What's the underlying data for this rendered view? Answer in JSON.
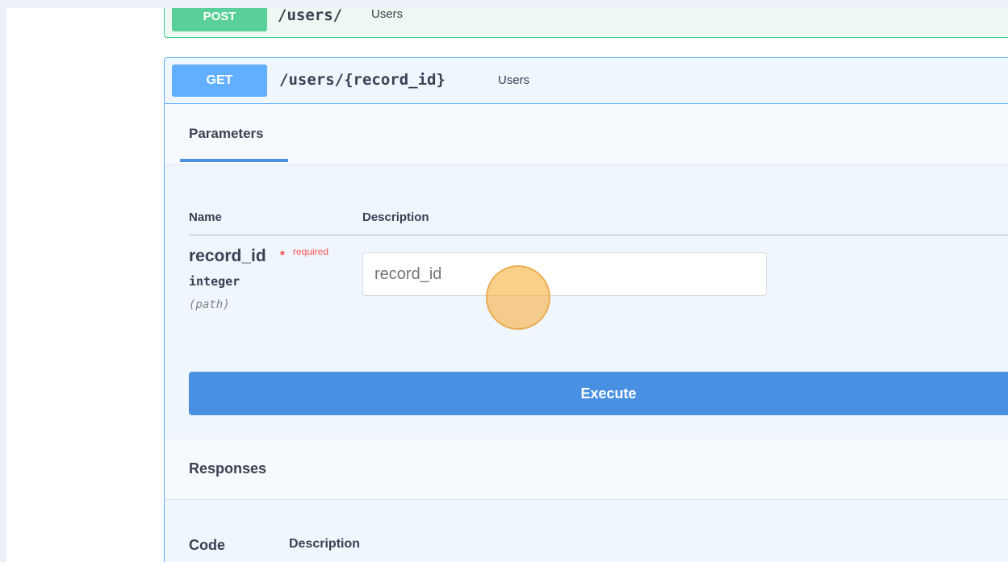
{
  "post_operation": {
    "method": "POST",
    "path": "/users/",
    "summary": "Users"
  },
  "get_operation": {
    "method": "GET",
    "path": "/users/{record_id}",
    "summary": "Users",
    "parameters_tab": "Parameters",
    "columns": {
      "name": "Name",
      "description": "Description"
    },
    "parameter": {
      "name": "record_id",
      "required_star": "*",
      "required_label": "required",
      "type": "integer",
      "in": "(path)",
      "input_placeholder": "record_id",
      "input_value": ""
    },
    "execute_label": "Execute",
    "responses": {
      "title": "Responses",
      "code_header": "Code",
      "description_header": "Description"
    }
  },
  "colors": {
    "post": "#49cc90",
    "get": "#61affe",
    "execute": "#4990e2",
    "required": "#ff3b3b"
  }
}
